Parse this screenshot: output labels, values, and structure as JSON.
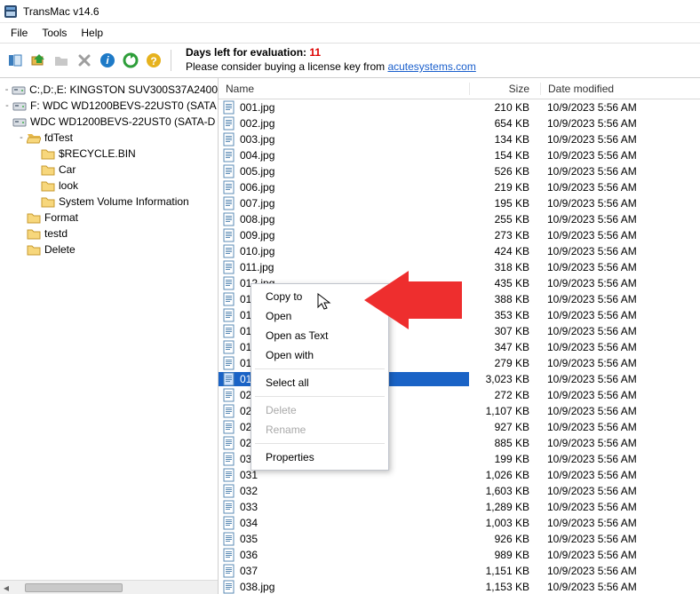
{
  "window": {
    "title": "TransMac v14.6"
  },
  "menu": {
    "file": "File",
    "tools": "Tools",
    "help": "Help"
  },
  "eval": {
    "days_label": "Days left for evaluation: ",
    "days_left": "11",
    "line2a": "Please consider buying a license key from ",
    "link": "acutesystems.com"
  },
  "tree": {
    "items": [
      {
        "expander": "-",
        "icon": "drive",
        "label": "C:,D:,E:  KINGSTON SUV300S37A2400",
        "indent": 0
      },
      {
        "expander": "-",
        "icon": "drive",
        "label": "F:  WDC WD1200BEVS-22UST0 (SATA",
        "indent": 0
      },
      {
        "expander": "",
        "icon": "drive",
        "label": "WDC WD1200BEVS-22UST0 (SATA-D",
        "indent": 0
      },
      {
        "expander": "-",
        "icon": "folder-open",
        "label": "fdTest",
        "indent": 1
      },
      {
        "expander": "",
        "icon": "folder",
        "label": "$RECYCLE.BIN",
        "indent": 2
      },
      {
        "expander": "",
        "icon": "folder",
        "label": "Car",
        "indent": 2
      },
      {
        "expander": "",
        "icon": "folder",
        "label": "look",
        "indent": 2
      },
      {
        "expander": "",
        "icon": "folder",
        "label": "System Volume Information",
        "indent": 2
      },
      {
        "expander": "",
        "icon": "folder",
        "label": "Format",
        "indent": 1
      },
      {
        "expander": "",
        "icon": "folder",
        "label": "testd",
        "indent": 1
      },
      {
        "expander": "",
        "icon": "folder",
        "label": "Delete",
        "indent": 1
      }
    ]
  },
  "list": {
    "headers": {
      "name": "Name",
      "size": "Size",
      "date": "Date modified"
    },
    "rows": [
      {
        "name": "001.jpg",
        "size": "210 KB",
        "date": "10/9/2023 5:56 AM"
      },
      {
        "name": "002.jpg",
        "size": "654 KB",
        "date": "10/9/2023 5:56 AM"
      },
      {
        "name": "003.jpg",
        "size": "134 KB",
        "date": "10/9/2023 5:56 AM"
      },
      {
        "name": "004.jpg",
        "size": "154 KB",
        "date": "10/9/2023 5:56 AM"
      },
      {
        "name": "005.jpg",
        "size": "526 KB",
        "date": "10/9/2023 5:56 AM"
      },
      {
        "name": "006.jpg",
        "size": "219 KB",
        "date": "10/9/2023 5:56 AM"
      },
      {
        "name": "007.jpg",
        "size": "195 KB",
        "date": "10/9/2023 5:56 AM"
      },
      {
        "name": "008.jpg",
        "size": "255 KB",
        "date": "10/9/2023 5:56 AM"
      },
      {
        "name": "009.jpg",
        "size": "273 KB",
        "date": "10/9/2023 5:56 AM"
      },
      {
        "name": "010.jpg",
        "size": "424 KB",
        "date": "10/9/2023 5:56 AM"
      },
      {
        "name": "011.jpg",
        "size": "318 KB",
        "date": "10/9/2023 5:56 AM"
      },
      {
        "name": "012.jpg",
        "size": "435 KB",
        "date": "10/9/2023 5:56 AM"
      },
      {
        "name": "013.jpg",
        "size": "388 KB",
        "date": "10/9/2023 5:56 AM"
      },
      {
        "name": "014.jpg",
        "size": "353 KB",
        "date": "10/9/2023 5:56 AM"
      },
      {
        "name": "015.jpg",
        "size": "307 KB",
        "date": "10/9/2023 5:56 AM"
      },
      {
        "name": "016.jpg",
        "size": "347 KB",
        "date": "10/9/2023 5:56 AM"
      },
      {
        "name": "018.jpg",
        "size": "279 KB",
        "date": "10/9/2023 5:56 AM"
      },
      {
        "name": "019.jpg",
        "size": "3,023 KB",
        "date": "10/9/2023 5:56 AM",
        "selected": true
      },
      {
        "name": "020",
        "size": "272 KB",
        "date": "10/9/2023 5:56 AM"
      },
      {
        "name": "021",
        "size": "1,107 KB",
        "date": "10/9/2023 5:56 AM"
      },
      {
        "name": "022",
        "size": "927 KB",
        "date": "10/9/2023 5:56 AM"
      },
      {
        "name": "023",
        "size": "885 KB",
        "date": "10/9/2023 5:56 AM"
      },
      {
        "name": "030",
        "size": "199 KB",
        "date": "10/9/2023 5:56 AM"
      },
      {
        "name": "031",
        "size": "1,026 KB",
        "date": "10/9/2023 5:56 AM"
      },
      {
        "name": "032",
        "size": "1,603 KB",
        "date": "10/9/2023 5:56 AM"
      },
      {
        "name": "033",
        "size": "1,289 KB",
        "date": "10/9/2023 5:56 AM"
      },
      {
        "name": "034",
        "size": "1,003 KB",
        "date": "10/9/2023 5:56 AM"
      },
      {
        "name": "035",
        "size": "926 KB",
        "date": "10/9/2023 5:56 AM"
      },
      {
        "name": "036",
        "size": "989 KB",
        "date": "10/9/2023 5:56 AM"
      },
      {
        "name": "037",
        "size": "1,151 KB",
        "date": "10/9/2023 5:56 AM"
      },
      {
        "name": "038.jpg",
        "size": "1,153 KB",
        "date": "10/9/2023 5:56 AM"
      }
    ]
  },
  "context_menu": {
    "items": [
      {
        "label": "Copy to",
        "type": "item"
      },
      {
        "label": "Open",
        "type": "item"
      },
      {
        "label": "Open as Text",
        "type": "item"
      },
      {
        "label": "Open with",
        "type": "item"
      },
      {
        "type": "sep"
      },
      {
        "label": "Select all",
        "type": "item"
      },
      {
        "type": "sep"
      },
      {
        "label": "Delete",
        "type": "item",
        "disabled": true
      },
      {
        "label": "Rename",
        "type": "item",
        "disabled": true
      },
      {
        "type": "sep"
      },
      {
        "label": "Properties",
        "type": "item"
      }
    ]
  }
}
